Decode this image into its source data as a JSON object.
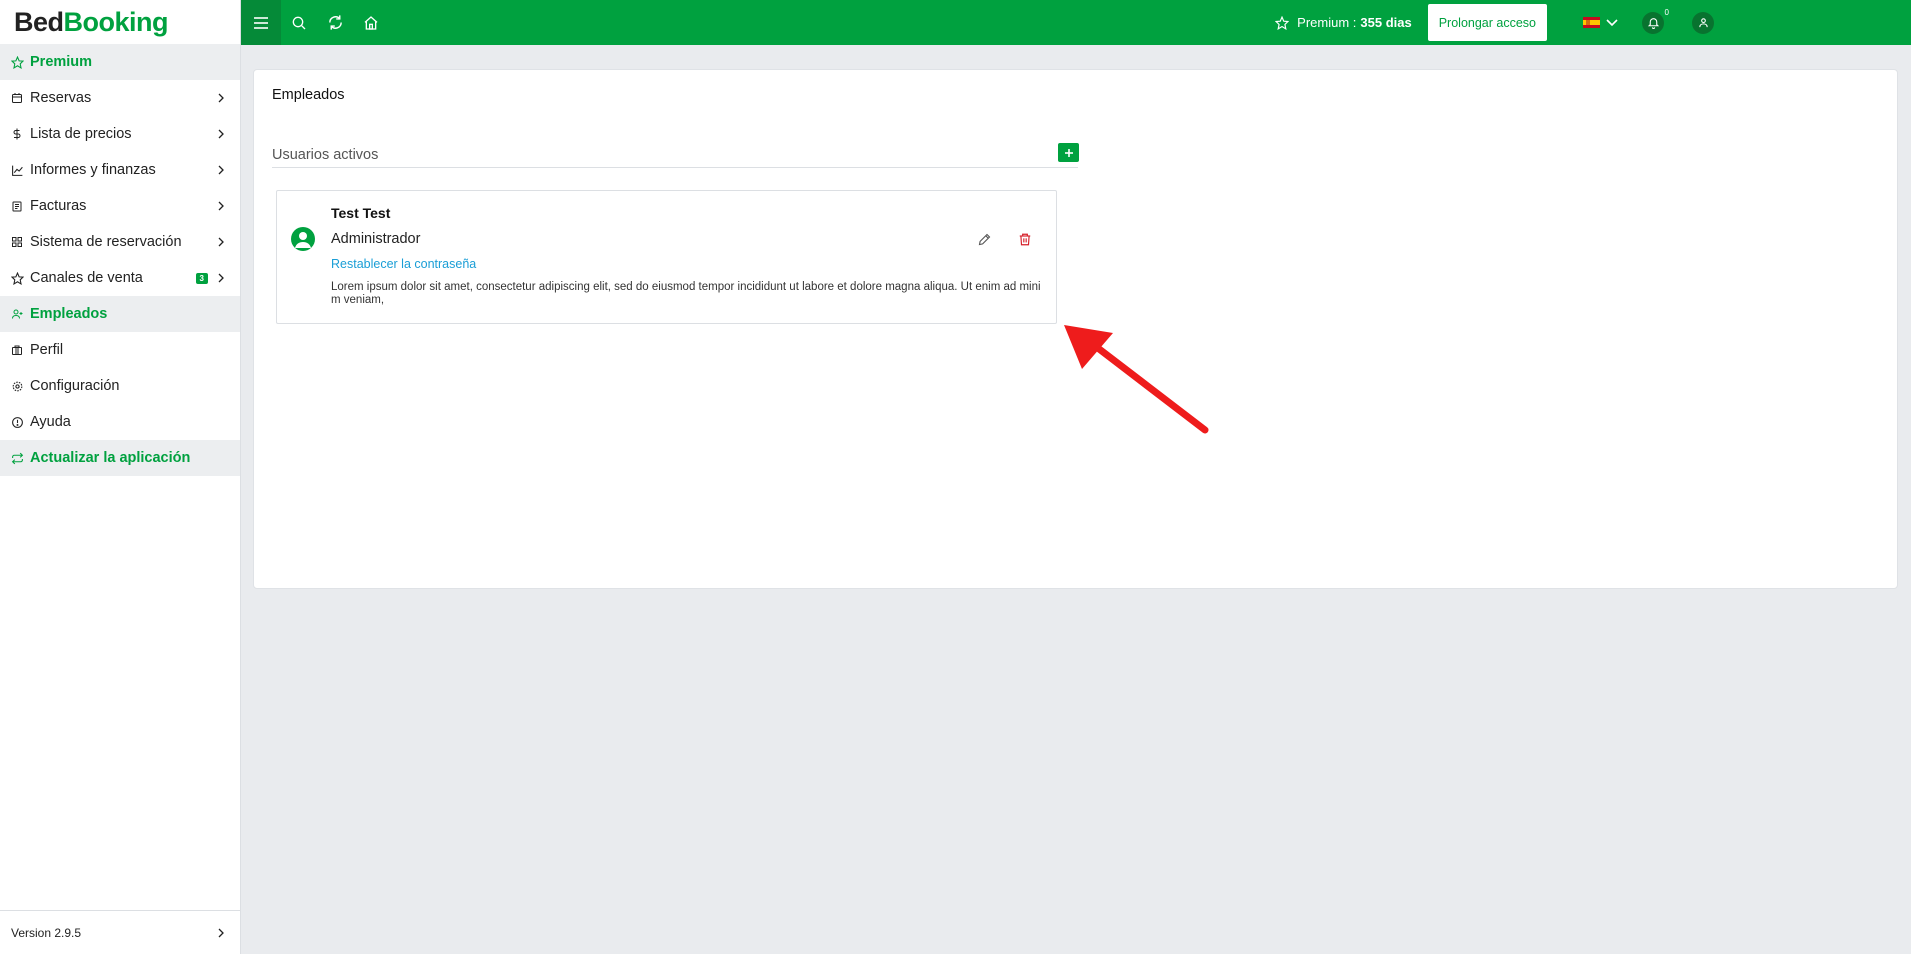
{
  "logo": {
    "part1": "Bed",
    "part2": "Booking"
  },
  "sidebar": {
    "items": [
      {
        "label": "Premium",
        "icon": "star-icon"
      },
      {
        "label": "Reservas",
        "icon": "calendar-icon"
      },
      {
        "label": "Lista de precios",
        "icon": "dollar-icon"
      },
      {
        "label": "Informes y finanzas",
        "icon": "chart-icon"
      },
      {
        "label": "Facturas",
        "icon": "invoice-icon"
      },
      {
        "label": "Sistema de reservación",
        "icon": "grid-icon"
      },
      {
        "label": "Canales de venta",
        "icon": "star-icon",
        "badge": "3"
      },
      {
        "label": "Empleados",
        "icon": "user-plus-icon"
      },
      {
        "label": "Perfil",
        "icon": "briefcase-icon"
      },
      {
        "label": "Configuración",
        "icon": "gear-icon"
      },
      {
        "label": "Ayuda",
        "icon": "info-icon"
      },
      {
        "label": "Actualizar la aplicación",
        "icon": "refresh-icon"
      }
    ],
    "version": "Version 2.9.5"
  },
  "topbar": {
    "premium_label": "Premium :",
    "premium_days": "355 dias",
    "prolong_button": "Prolongar acceso",
    "notification_count": "0",
    "accent": "#00a13f"
  },
  "main": {
    "title": "Empleados",
    "section_title": "Usuarios activos",
    "user": {
      "name": "Test Test",
      "role": "Administrador",
      "reset_link": "Restablecer la contraseña",
      "description": "Lorem ipsum dolor sit amet, consectetur adipiscing elit, sed do eiusmod tempor incididunt ut labore et dolore magna aliqua. Ut enim ad minim veniam,"
    }
  }
}
